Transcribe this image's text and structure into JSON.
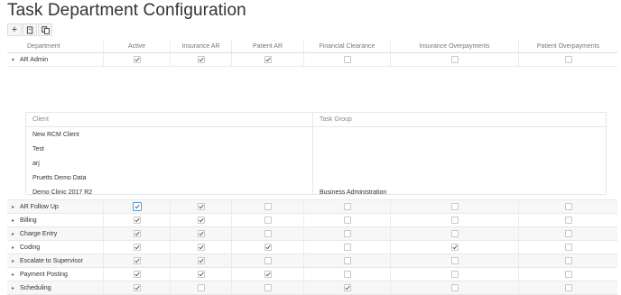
{
  "page_title": "Task Department Configuration",
  "toolbar": {
    "add": "+",
    "edit_icon": "edit-icon",
    "copy_icon": "copy-icon"
  },
  "columns": [
    "Department",
    "Active",
    "Insurance AR",
    "Patient AR",
    "Financial Clearance",
    "Insurance Overpayments",
    "Patient Overpayments"
  ],
  "expanded": {
    "name": "AR Admin",
    "expanded": true,
    "flags": [
      true,
      true,
      true,
      false,
      false,
      false
    ],
    "subtable": {
      "headers": [
        "Client",
        "Task Group"
      ],
      "rows": [
        {
          "client": "New RCM Client",
          "task_group": ""
        },
        {
          "client": "Test",
          "task_group": ""
        },
        {
          "client": "arj",
          "task_group": ""
        },
        {
          "client": "Pruetts Demo Data",
          "task_group": ""
        },
        {
          "client": "Demo Clinic 2017 R2",
          "task_group": "Business Administration"
        }
      ]
    }
  },
  "departments": [
    {
      "name": "AR Follow Up",
      "flags": [
        true,
        true,
        false,
        false,
        false,
        false
      ]
    },
    {
      "name": "Billing",
      "flags": [
        true,
        true,
        false,
        false,
        false,
        false
      ]
    },
    {
      "name": "Charge Entry",
      "flags": [
        true,
        true,
        false,
        false,
        false,
        false
      ]
    },
    {
      "name": "Coding",
      "flags": [
        true,
        true,
        true,
        false,
        true,
        false
      ]
    },
    {
      "name": "Escalate to Supervisor",
      "flags": [
        true,
        true,
        false,
        false,
        false,
        false
      ]
    },
    {
      "name": "Payment Posting",
      "flags": [
        true,
        true,
        true,
        false,
        false,
        false
      ]
    },
    {
      "name": "Scheduling",
      "flags": [
        true,
        false,
        false,
        true,
        false,
        false
      ]
    }
  ]
}
